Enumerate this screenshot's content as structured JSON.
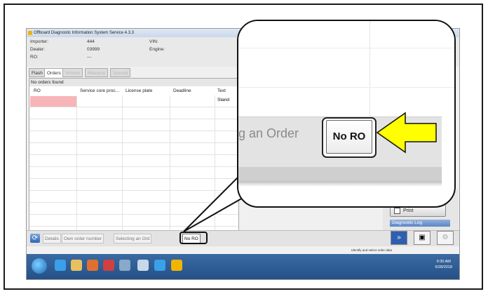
{
  "window": {
    "title": "Offboard Diagnostic Information System Service   4.3.3"
  },
  "info": {
    "importer_label": "Importer:",
    "importer_value": "444",
    "dealer_label": "Dealer:",
    "dealer_value": "03999",
    "ro_label": "RO:",
    "ro_value": "---",
    "vin_label": "VIN:",
    "engine_label": "Engine:"
  },
  "tabs": [
    "Flash",
    "Orders",
    "Vehicle",
    "Measure",
    "Special"
  ],
  "orders": {
    "status_text": "No orders found",
    "columns": [
      "RO",
      "Service core proc...",
      "License plate",
      "Deadline",
      "Text"
    ],
    "first_row_text": "Stand"
  },
  "bottom_buttons": {
    "details": "Details",
    "own_order": "Own order number",
    "selecting": "Selecting an Ord",
    "no_ro": "No RO"
  },
  "side": {
    "print_label": "Print",
    "diag_log_label": "Diagnostic Log"
  },
  "statusline": {
    "text": "Identify and select order data"
  },
  "taskbar": {
    "time": "9:30 AM",
    "date": "6/28/2018"
  },
  "callout": {
    "selecting_text": "g an Order",
    "no_ro_label": "No RO"
  },
  "colors": {
    "arrow_fill": "#ffff00",
    "selected_row": "#f7b5b8",
    "taskbar": "#2b5a94"
  }
}
